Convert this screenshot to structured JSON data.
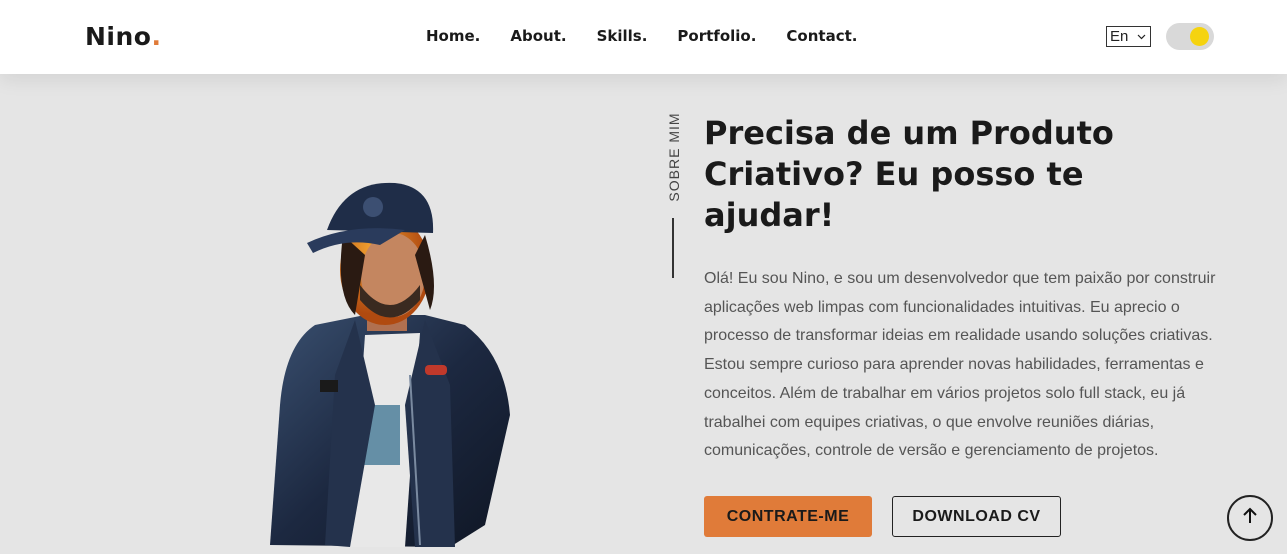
{
  "header": {
    "logo_text": "Nino",
    "logo_dot": ".",
    "nav": [
      "Home.",
      "About.",
      "Skills.",
      "Portfolio.",
      "Contact."
    ],
    "language": "En",
    "theme_toggle_state": "light"
  },
  "about": {
    "side_label": "SOBRE MIM",
    "headline": "Precisa de um Produto Criativo? Eu posso te ajudar!",
    "paragraph": "Olá! Eu sou Nino, e sou um desenvolvedor que tem paixão por construir aplicações web limpas com funcionalidades intuitivas. Eu aprecio o processo de transformar ideias em realidade usando soluções criativas. Estou sempre curioso para aprender novas habilidades, ferramentas e conceitos. Além de trabalhar em vários projetos solo full stack, eu já trabalhei com equipes criativas, o que envolve reuniões diárias, comunicações, controle de versão e gerenciamento de projetos.",
    "hire_button": "CONTRATE-ME",
    "cv_button": "DOWNLOAD CV"
  },
  "colors": {
    "accent": "#e07b39",
    "toggle_knob": "#f5d30f",
    "background": "#e5e5e5"
  },
  "icons": {
    "scroll_top": "arrow-up-icon",
    "language_chevron": "chevron-down-icon"
  }
}
